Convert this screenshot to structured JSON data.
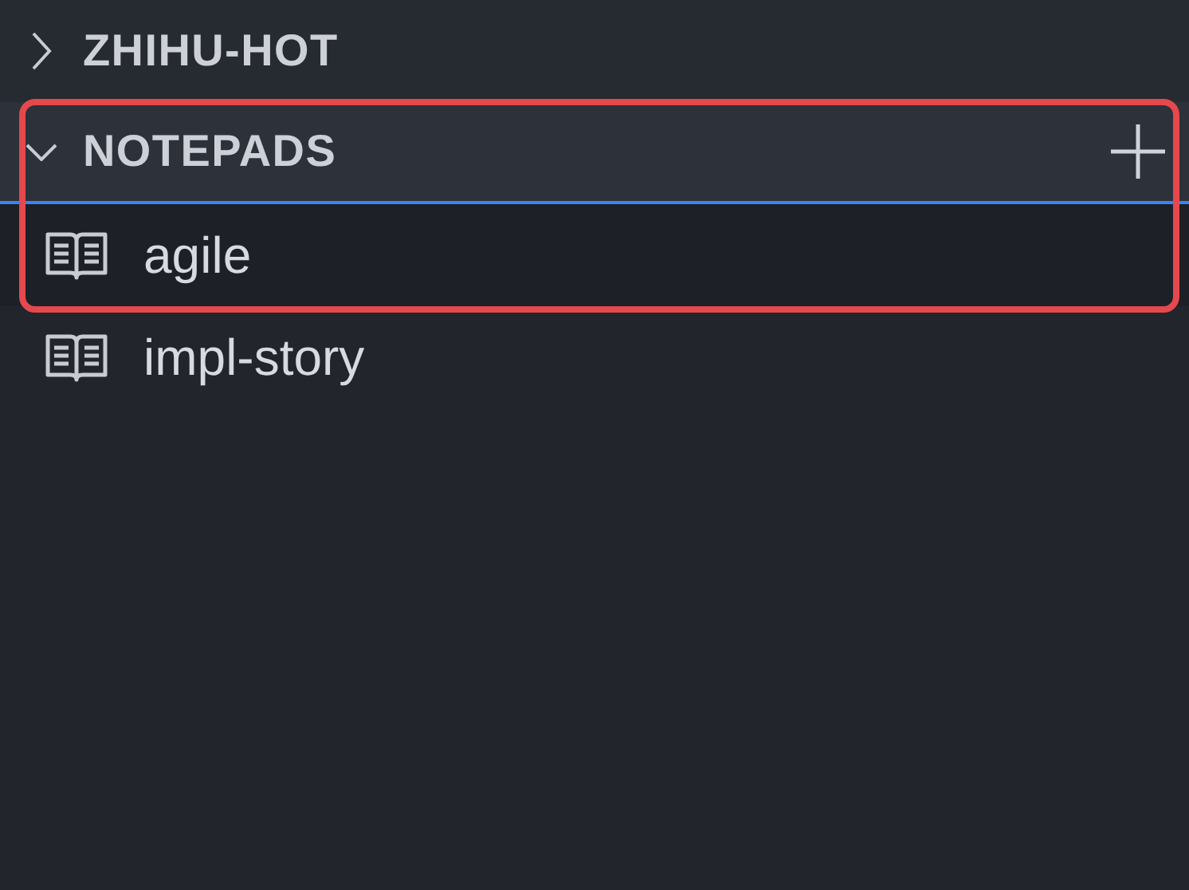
{
  "sections": [
    {
      "title": "ZHIHU-HOT",
      "expanded": false,
      "focused": false
    },
    {
      "title": "NOTEPADS",
      "expanded": true,
      "focused": true,
      "add_button": true,
      "items": [
        {
          "label": "agile",
          "selected": true
        },
        {
          "label": "impl-story",
          "selected": false
        }
      ]
    }
  ]
}
